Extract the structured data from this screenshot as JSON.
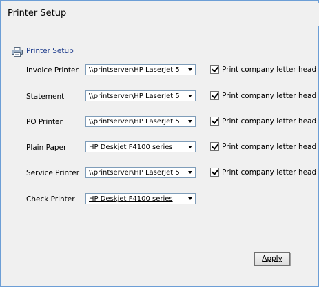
{
  "window": {
    "title": "Printer Setup"
  },
  "group": {
    "title": "Printer Setup",
    "icon": "printer-icon"
  },
  "rows": [
    {
      "label": "Invoice Printer",
      "printer": "\\\\printserver\\HP LaserJet 5",
      "letterhead_label": "Print company letter head",
      "letterhead_checked": true
    },
    {
      "label": "Statement",
      "printer": "\\\\printserver\\HP LaserJet 5",
      "letterhead_label": "Print company letter head",
      "letterhead_checked": true
    },
    {
      "label": "PO Printer",
      "printer": "\\\\printserver\\HP LaserJet 5",
      "letterhead_label": "Print company letter head",
      "letterhead_checked": true
    },
    {
      "label": "Plain Paper",
      "printer": "HP Deskjet F4100 series",
      "letterhead_label": "Print company letter head",
      "letterhead_checked": true
    },
    {
      "label": "Service Printer",
      "printer": "\\\\printserver\\HP LaserJet 5",
      "letterhead_label": "Print company letter head",
      "letterhead_checked": true
    },
    {
      "label": "Check Printer",
      "printer": "HP Deskjet F4100 series"
    }
  ],
  "apply_button": {
    "label": "Apply"
  },
  "colors": {
    "border": "#6c9ed6",
    "background": "#f0f0f0",
    "group_title": "#1e3c8c"
  }
}
